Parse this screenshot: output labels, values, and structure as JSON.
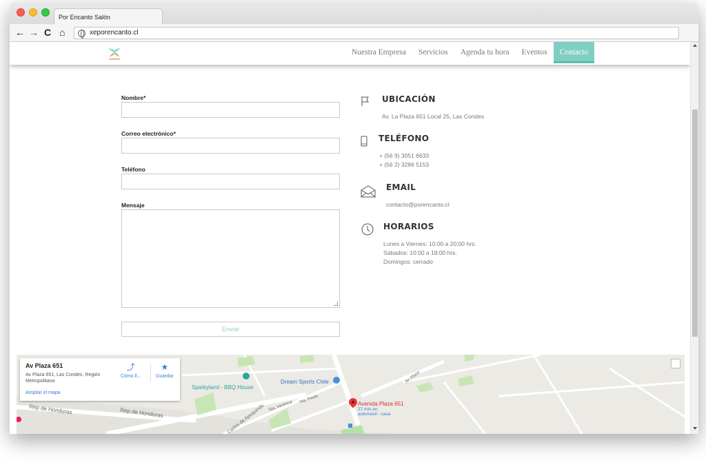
{
  "browser": {
    "tab_title": "Por Encanto Salón",
    "url": "xeporencanto.cl",
    "back_icon": "←",
    "forward_icon": "→",
    "reload_icon": "C",
    "home_icon": "⌂"
  },
  "header": {
    "menu": [
      {
        "label": "Nuestra Empresa"
      },
      {
        "label": "Servicios"
      },
      {
        "label": "Agenda tu hora"
      },
      {
        "label": "Eventos"
      },
      {
        "label": "Contacto"
      }
    ],
    "active_color": "#7fcfc2"
  },
  "form": {
    "name_label": "Nombre*",
    "email_label": "Correo electrónico*",
    "phone_label": "Teléfono",
    "message_label": "Mensaje",
    "name_value": "",
    "email_value": "",
    "phone_value": "",
    "message_value": "",
    "submit_label": "Enviar"
  },
  "info": {
    "location": {
      "title": "UBICACIÓN",
      "text": "Av. La Plaza 651 Local 25, Las Condes"
    },
    "phone": {
      "title": "TELÉFONO",
      "line1": "+ (56 9) 3051 6633",
      "line2": "+ (56 2) 3286 5153"
    },
    "email": {
      "title": "EMAIL",
      "text": "contacto@porencanto.cl"
    },
    "hours": {
      "title": "HORARIOS",
      "line1": "Lunes a Viernes: 10:00 a 20:00 hrs.",
      "line2": "Sábados: 10:00 a 18:00 hrs.",
      "line3": "Domingos: cerrado"
    }
  },
  "map": {
    "card_title": "Av Plaza 651",
    "card_address": "Av Plaza 651, Las Condes, Región Metropolitana",
    "directions_label": "Cómo ll...",
    "save_label": "Guardar",
    "enlarge_label": "Ampliar el mapa",
    "places": {
      "sparkyland": "Sparkyland - BBQ House",
      "dream_sports": "Dream Sports Chile",
      "destination": "Avenida Plaza 651",
      "destination_sub1": "27 min en",
      "destination_sub2": "automóvil - casa",
      "rep_honduras_1": "Rep de Honduras",
      "rep_honduras_2": "Rep de Honduras",
      "carlos_apoquindo": "Carlos de Apoquindo",
      "sta_paula": "Sta. Paula",
      "sta_veronica": "Sta. Verónica",
      "av_plaza": "Av. Plaza"
    }
  }
}
